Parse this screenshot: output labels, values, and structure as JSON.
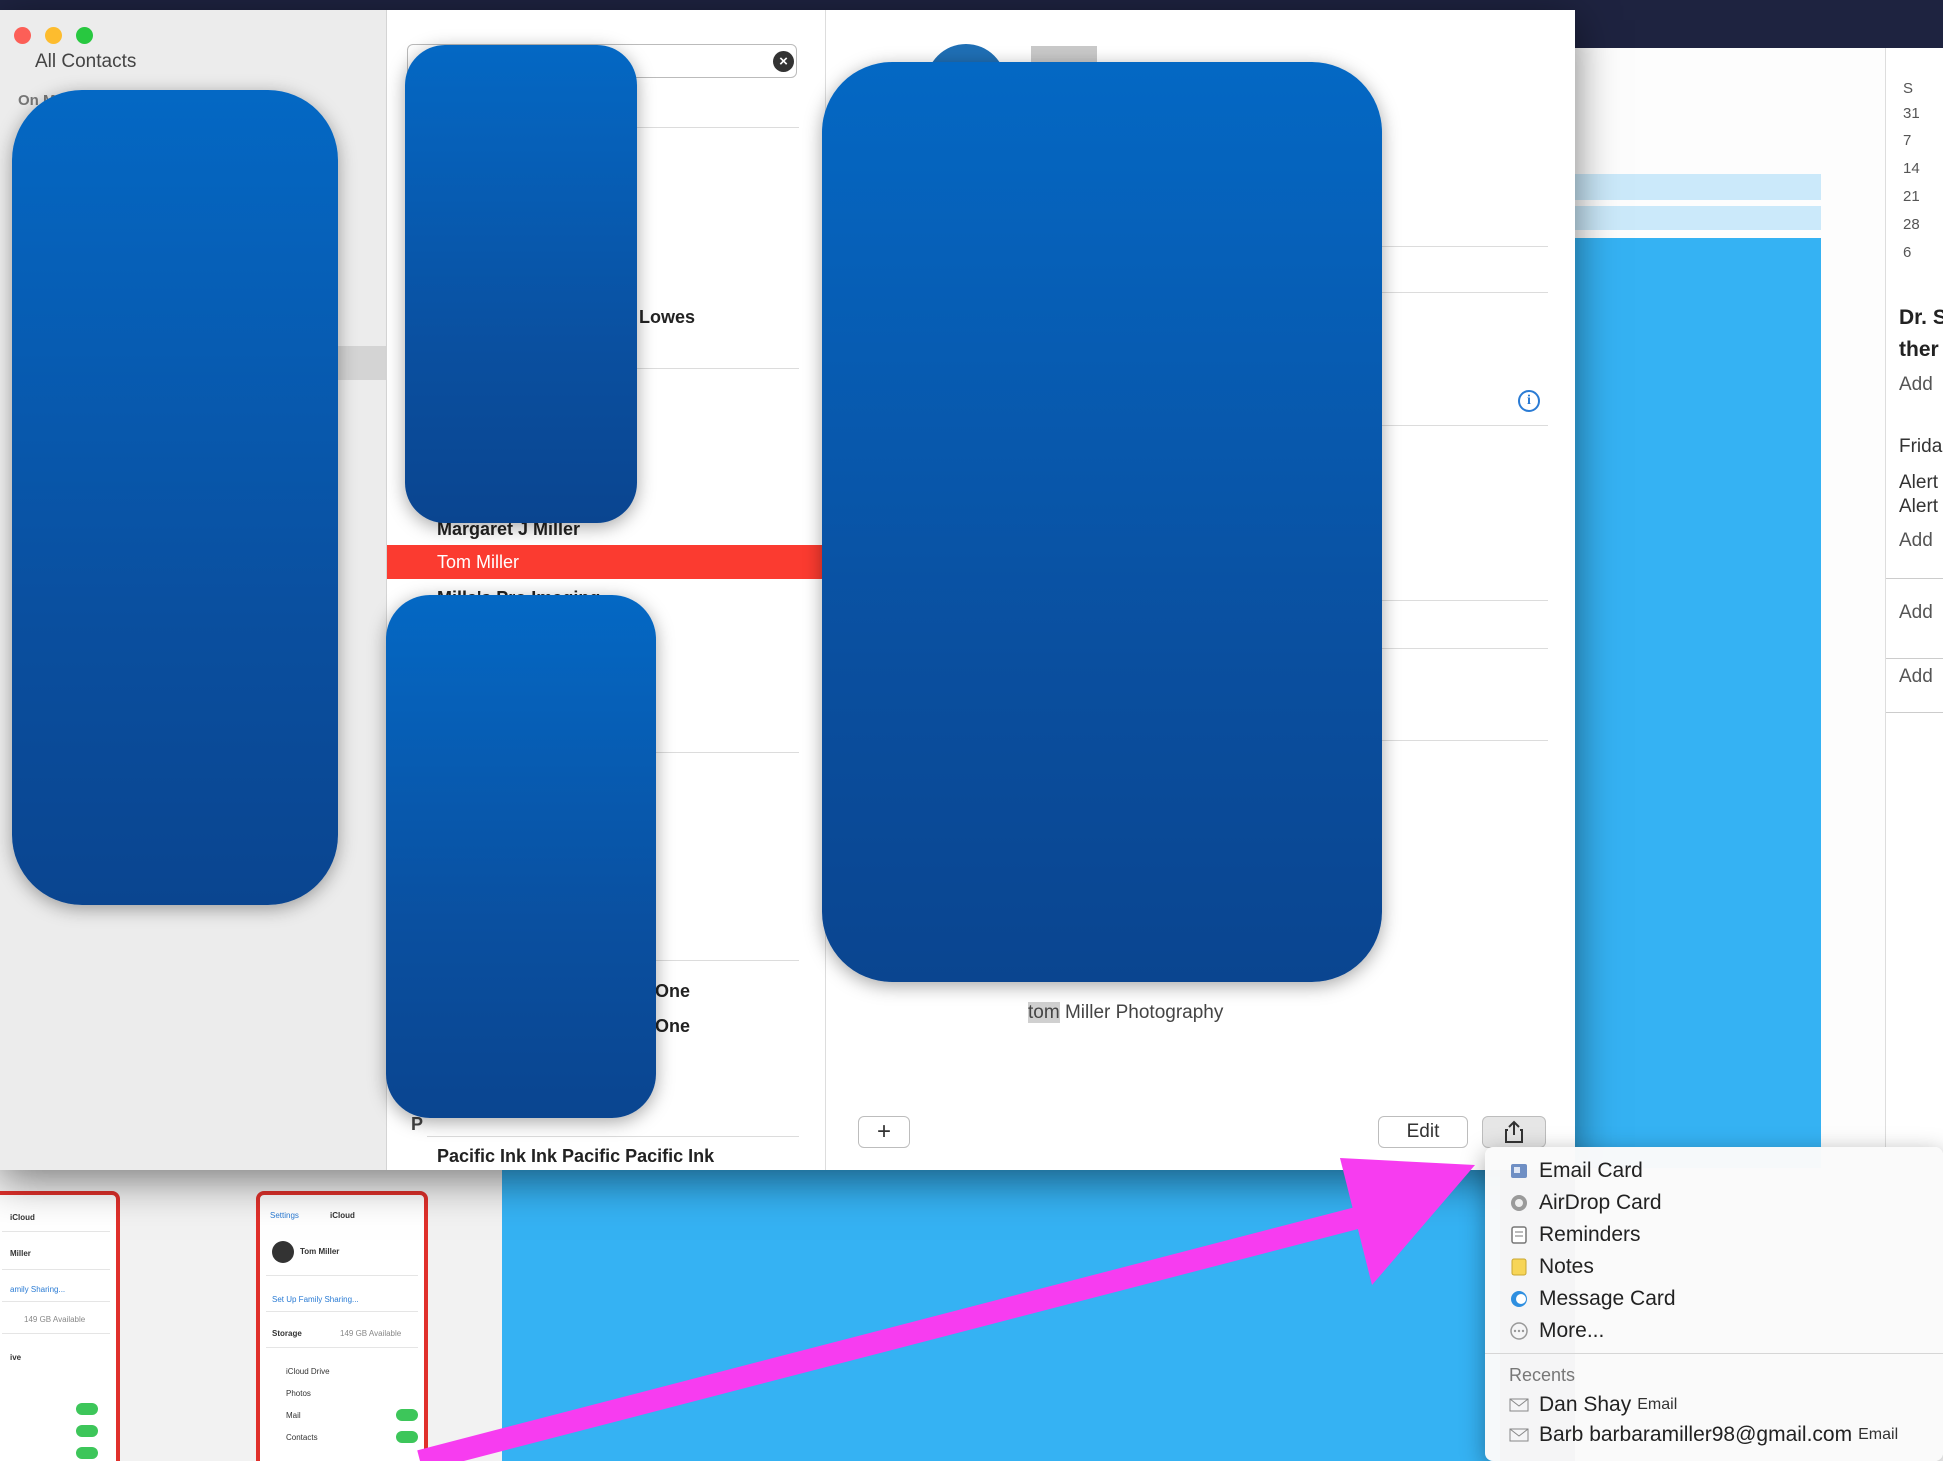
{
  "sidebar": {
    "title": "All Contacts",
    "group_label": "On M"
  },
  "list": {
    "items": [
      {
        "label": "re Lowes"
      },
      {
        "label": "Margaret J Miller"
      },
      {
        "label": "Tom Miller"
      },
      {
        "label": "Milla's Pro Imaging"
      },
      {
        "label": "One"
      },
      {
        "label": "One"
      },
      {
        "label": "Pacific Ink Ink Pacific Pacific Ink"
      }
    ],
    "section_p": "P",
    "selected_label": "Tom Miller"
  },
  "detail": {
    "company_highlight": "tom",
    "company_rest": " Miller Photography",
    "add_button": "+",
    "edit_button": "Edit",
    "info_icon": "info-icon",
    "share_icon": "share-icon"
  },
  "calendar": {
    "day_header": "S",
    "days": [
      "31",
      "7",
      "14",
      "21",
      "28",
      "6"
    ],
    "event_title_1": "Dr. S",
    "event_title_2": "ther",
    "add_location": "Add",
    "date_text": "Frida",
    "alert_1": "Alert",
    "alert_2": "Alert",
    "add_alert": "Add",
    "add_invitees": "Add",
    "add_notes": "Add"
  },
  "share_menu": {
    "items": [
      {
        "label": "Email Card",
        "icon": "email-card-icon"
      },
      {
        "label": "AirDrop Card",
        "icon": "airdrop-icon"
      },
      {
        "label": "Reminders",
        "icon": "reminders-icon"
      },
      {
        "label": "Notes",
        "icon": "notes-icon"
      },
      {
        "label": "Message Card",
        "icon": "messages-icon"
      },
      {
        "label": "More...",
        "icon": "more-icon"
      }
    ],
    "recents_title": "Recents",
    "recents": [
      {
        "name": "Dan Shay",
        "type": "Email"
      },
      {
        "name": "Barb barbaramiller98@gmail.com",
        "type": "Email"
      }
    ]
  },
  "phone_left": {
    "title": "iCloud",
    "name": "Miller",
    "family": "amily Sharing...",
    "storage": "149 GB Available",
    "drive": "ive"
  },
  "phone_right": {
    "back": "Settings",
    "title": "iCloud",
    "name": "Tom Miller",
    "family": "Set Up Family Sharing...",
    "storage_label": "Storage",
    "storage_value": "149 GB Available",
    "rows": [
      "iCloud Drive",
      "Photos",
      "Mail",
      "Contacts"
    ]
  },
  "colors": {
    "selection": "#fb3b30",
    "arrow": "#f73cf0",
    "desktop_blue": "#35b2f3",
    "redaction": "#0a55a8"
  }
}
